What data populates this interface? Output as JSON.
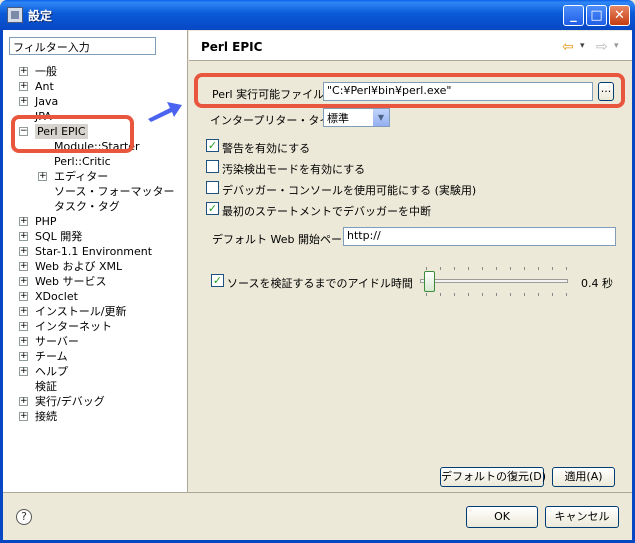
{
  "window": {
    "title": "設定",
    "controls": {
      "minimize": "_",
      "maximize": "□",
      "close": "✕"
    }
  },
  "filter": {
    "value": "フィルター入力"
  },
  "tree": [
    {
      "label": "一般",
      "expandable": true
    },
    {
      "label": "Ant",
      "expandable": true
    },
    {
      "label": "Java",
      "expandable": true
    },
    {
      "label": "JPA",
      "expandable": false
    },
    {
      "label": "Perl EPIC",
      "expandable": true,
      "expanded": true,
      "selected": true
    },
    {
      "label": "Module::Starter",
      "expandable": false
    },
    {
      "label": "Perl::Critic",
      "expandable": false
    },
    {
      "label": "エディター",
      "expandable": true
    },
    {
      "label": "ソース・フォーマッター",
      "expandable": false
    },
    {
      "label": "タスク・タグ",
      "expandable": false
    },
    {
      "label": "PHP",
      "expandable": true
    },
    {
      "label": "SQL 開発",
      "expandable": true
    },
    {
      "label": "Star-1.1 Environment",
      "expandable": true
    },
    {
      "label": "Web および XML",
      "expandable": true
    },
    {
      "label": "Web サービス",
      "expandable": true
    },
    {
      "label": "XDoclet",
      "expandable": true
    },
    {
      "label": "インストール/更新",
      "expandable": true
    },
    {
      "label": "インターネット",
      "expandable": true
    },
    {
      "label": "サーバー",
      "expandable": true
    },
    {
      "label": "チーム",
      "expandable": true
    },
    {
      "label": "ヘルプ",
      "expandable": true
    },
    {
      "label": "検証",
      "expandable": false
    },
    {
      "label": "実行/デバッグ",
      "expandable": true
    },
    {
      "label": "接続",
      "expandable": true
    }
  ],
  "page": {
    "title": "Perl EPIC",
    "nav": {
      "back_icon": "⇦",
      "back_menu": "▾",
      "forward_icon": "⇨",
      "forward_menu": "▾"
    },
    "executable": {
      "label": "Perl 実行可能ファイル:",
      "value": "\"C:¥Perl¥bin¥perl.exe\"",
      "browse": "..."
    },
    "interpreter": {
      "label": "インタープリター・タイプ:",
      "value": "標準"
    },
    "checkboxes": [
      {
        "label": "警告を有効にする",
        "checked": true
      },
      {
        "label": "汚染検出モードを有効にする",
        "checked": false
      },
      {
        "label": "デバッガー・コンソールを使用可能にする (実験用)",
        "checked": false
      },
      {
        "label": "最初のステートメントでデバッガーを中断",
        "checked": true
      }
    ],
    "web_start": {
      "label": "デフォルト Web 開始ページ:",
      "value": "http://"
    },
    "idle": {
      "label": "ソースを検証するまでのアイドル時間",
      "checked": true,
      "value_text": "0.4 秒",
      "slider_fraction": 0.02
    },
    "restore_defaults": "デフォルトの復元(D)",
    "apply": "適用(A)"
  },
  "footer": {
    "help_icon": "?",
    "ok": "OK",
    "cancel": "キャンセル"
  },
  "colors": {
    "callout": "#e8563e",
    "arrow": "#4a63f0",
    "titlebar": "#0a5ad8"
  }
}
